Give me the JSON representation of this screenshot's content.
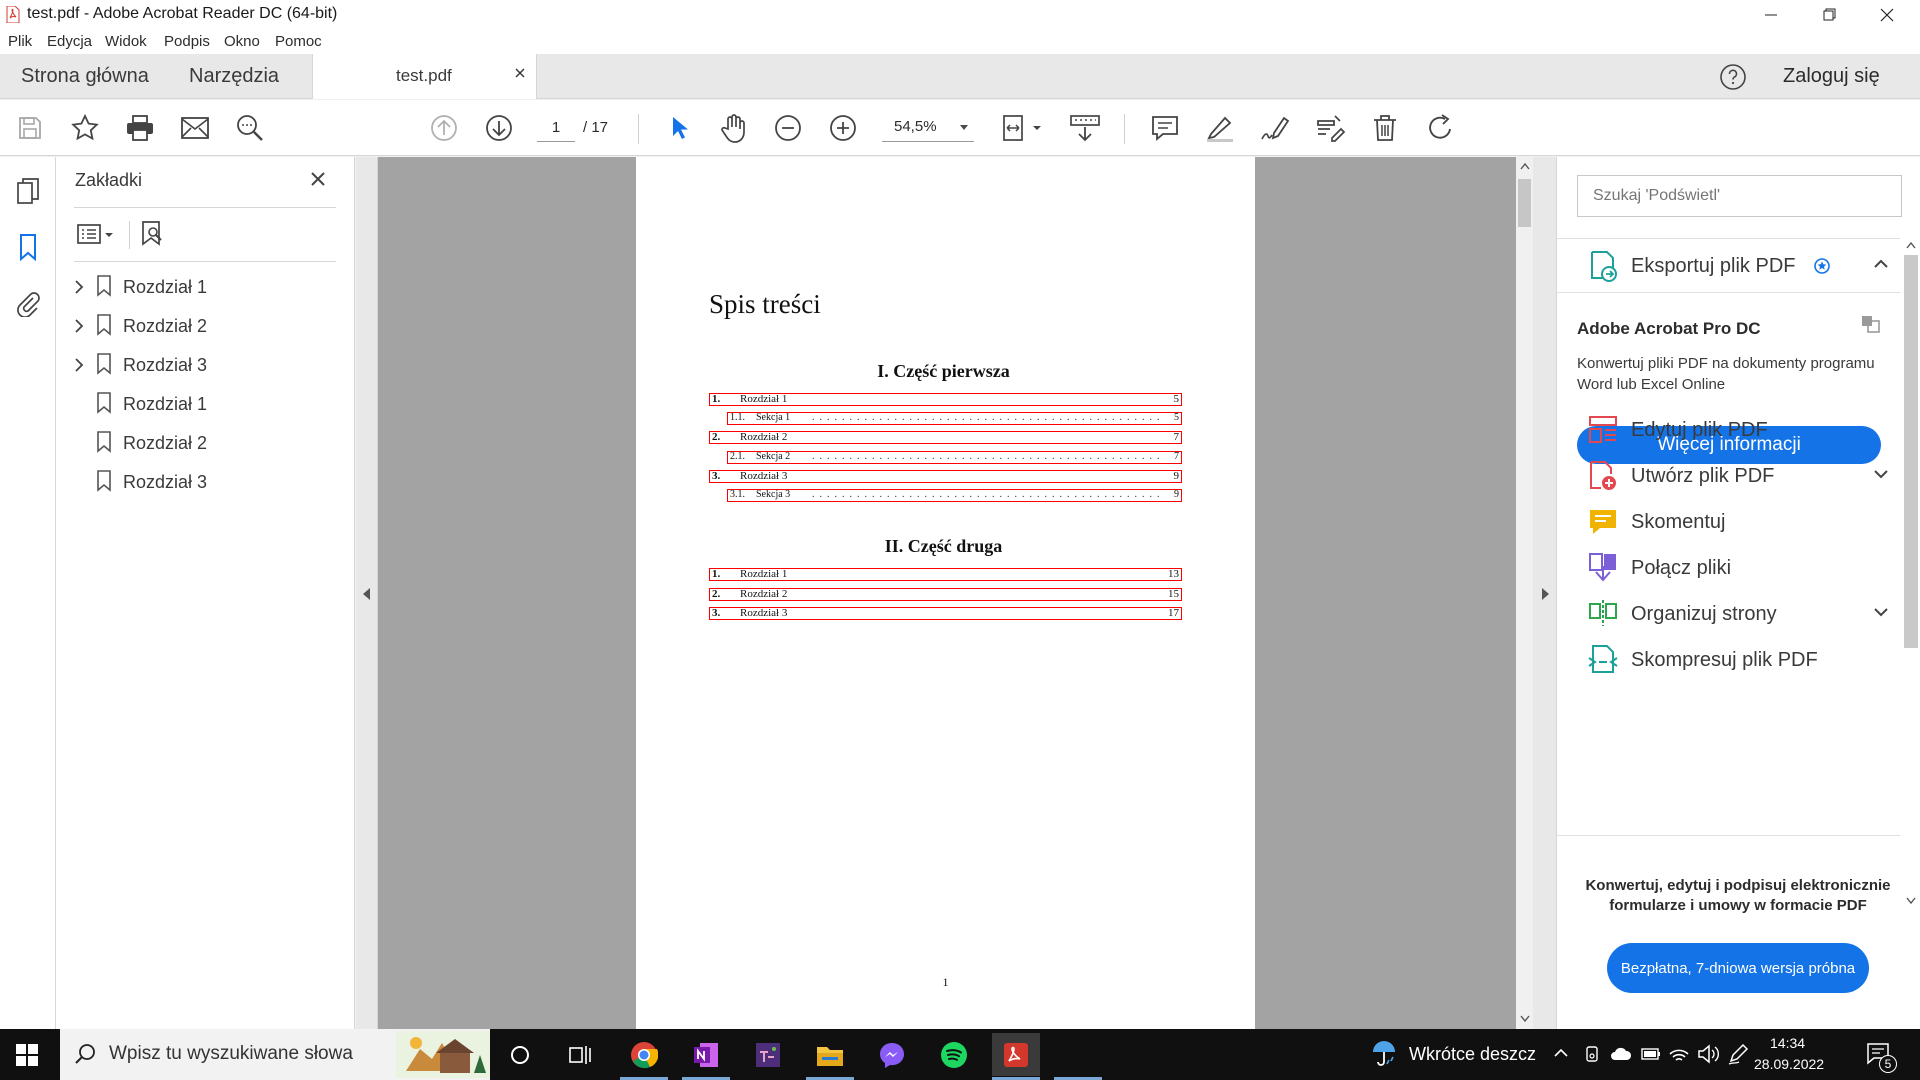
{
  "window": {
    "title": "test.pdf - Adobe Acrobat Reader DC (64-bit)",
    "controls": [
      "minimize-icon",
      "restore-icon",
      "close-icon"
    ]
  },
  "menu": [
    "Plik",
    "Edycja",
    "Widok",
    "Podpis",
    "Okno",
    "Pomoc"
  ],
  "tabs": {
    "home": "Strona główna",
    "tools": "Narzędzia",
    "document": "test.pdf",
    "login": "Zaloguj się"
  },
  "toolbar": {
    "page_current": "1",
    "page_total": "/ 17",
    "zoom": "54,5%",
    "icons": [
      "save-icon",
      "star-icon",
      "print-icon",
      "mail-icon",
      "search-icon",
      "prev-page-icon",
      "next-page-icon",
      "select-cursor-icon",
      "hand-icon",
      "zoom-out-icon",
      "zoom-in-icon",
      "fit-page-icon",
      "read-mode-icon",
      "comment-icon",
      "highlight-pen-icon",
      "sign-icon",
      "edit-text-icon",
      "delete-icon",
      "rotate-icon"
    ]
  },
  "bookmarks": {
    "title": "Zakładki",
    "items": [
      {
        "label": "Rozdział 1",
        "expandable": true
      },
      {
        "label": "Rozdział 2",
        "expandable": true
      },
      {
        "label": "Rozdział 3",
        "expandable": true
      },
      {
        "label": "Rozdział 1",
        "expandable": false
      },
      {
        "label": "Rozdział 2",
        "expandable": false
      },
      {
        "label": "Rozdział 3",
        "expandable": false
      }
    ]
  },
  "document": {
    "heading": "Spis treści",
    "parts": [
      {
        "title": "I.   Część pierwsza",
        "entries": [
          {
            "kind": "chapter",
            "num": "1.",
            "label": "Rozdział 1",
            "page": "5"
          },
          {
            "kind": "section",
            "num": "1.1.",
            "label": "Sekcja 1",
            "page": "5"
          },
          {
            "kind": "chapter",
            "num": "2.",
            "label": "Rozdział 2",
            "page": "7"
          },
          {
            "kind": "section",
            "num": "2.1.",
            "label": "Sekcja 2",
            "page": "7"
          },
          {
            "kind": "chapter",
            "num": "3.",
            "label": "Rozdział 3",
            "page": "9"
          },
          {
            "kind": "section",
            "num": "3.1.",
            "label": "Sekcja 3",
            "page": "9"
          }
        ]
      },
      {
        "title": "II.   Część druga",
        "entries": [
          {
            "kind": "chapter",
            "num": "1.",
            "label": "Rozdział 1",
            "page": "13"
          },
          {
            "kind": "chapter",
            "num": "2.",
            "label": "Rozdział 2",
            "page": "15"
          },
          {
            "kind": "chapter",
            "num": "3.",
            "label": "Rozdział 3",
            "page": "17"
          }
        ]
      }
    ],
    "page_number": "1",
    "highlight_color": "#ff0000"
  },
  "right_panel": {
    "search_placeholder": "Szukaj 'Podświetl'",
    "export": "Eksportuj plik PDF",
    "pro_title": "Adobe Acrobat Pro DC",
    "pro_desc": "Konwertuj pliki PDF na dokumenty programu Word lub Excel Online",
    "more_info": "Więcej informacji",
    "tools": [
      {
        "label": "Edytuj plik PDF",
        "icon": "edit-pdf-icon",
        "color": "#e34850",
        "chevron": false
      },
      {
        "label": "Utwórz plik PDF",
        "icon": "create-pdf-icon",
        "color": "#e34850",
        "chevron": true
      },
      {
        "label": "Skomentuj",
        "icon": "comment-tool-icon",
        "color": "#f0b400",
        "chevron": false
      },
      {
        "label": "Połącz pliki",
        "icon": "combine-files-icon",
        "color": "#7a5fd6",
        "chevron": false
      },
      {
        "label": "Organizuj strony",
        "icon": "organize-pages-icon",
        "color": "#2da44e",
        "chevron": true
      },
      {
        "label": "Skompresuj plik PDF",
        "icon": "compress-pdf-icon",
        "color": "#1aa19b",
        "chevron": false
      }
    ],
    "promo": "Konwertuj, edytuj i podpisuj elektronicznie formularze i umowy w formacie PDF",
    "trial": "Bezpłatna, 7-dniowa wersja próbna",
    "accent": "#1473e6"
  },
  "taskbar": {
    "search_placeholder": "Wpisz tu wyszukiwane słowa",
    "weather": "Wkrótce deszcz",
    "time": "14:34",
    "date": "28.09.2022",
    "notifications": "5",
    "apps": [
      "cortana-icon",
      "task-view-icon",
      "chrome-icon",
      "onenote-icon",
      "tex-icon",
      "file-explorer-icon",
      "messenger-icon",
      "spotify-icon",
      "acrobat-icon"
    ]
  }
}
